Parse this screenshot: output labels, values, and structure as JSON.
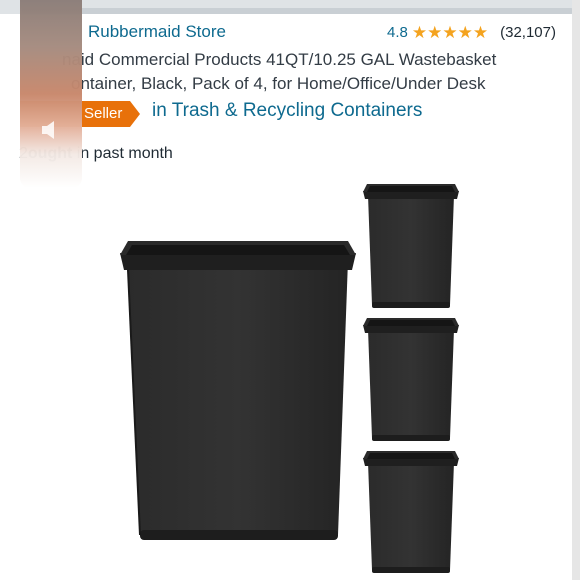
{
  "header": {
    "store_link": "Rubbermaid Store",
    "rating_value": "4.8",
    "rating_count": "(32,107)",
    "stars": [
      "star-icon",
      "star-icon",
      "star-icon",
      "star-icon",
      "star-half-icon"
    ]
  },
  "product": {
    "title_line1": "naid Commercial Products 41QT/10.25 GAL Wastebasket",
    "title_line2": "ontainer, Black, Pack of 4, for Home/Office/Under Desk",
    "badge_label": "Seller",
    "category_label": "in Trash & Recycling Containers",
    "bought_prefix": "2",
    "bought_bold": "ought",
    "bought_suffix": " in past month"
  },
  "colors": {
    "link": "#0e6a8f",
    "badge": "#e8710a",
    "star": "#f4a31f",
    "bin": "#262626"
  },
  "icons": {
    "overlay": "volume-icon"
  }
}
